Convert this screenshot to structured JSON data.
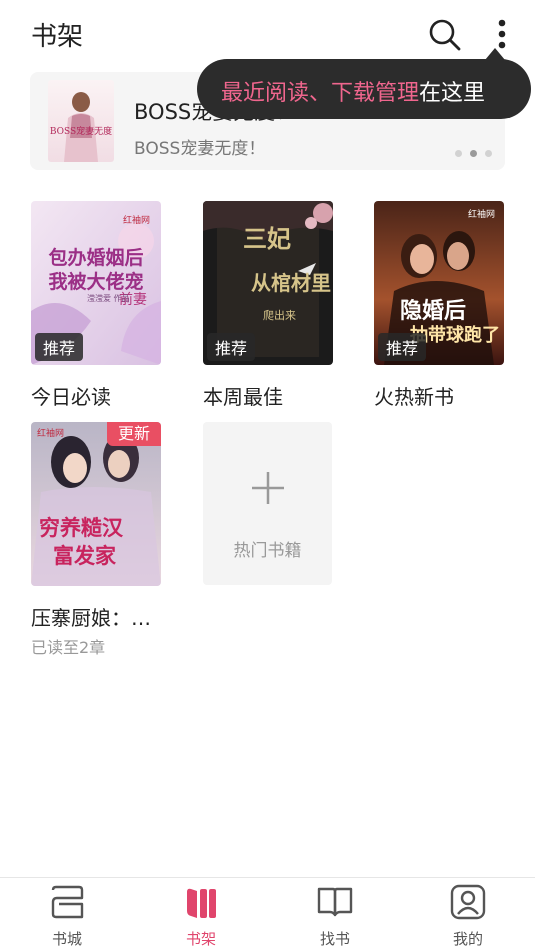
{
  "header": {
    "title": "书架",
    "search_icon": "search-icon",
    "more_icon": "more-vertical-icon"
  },
  "banner": {
    "title": "BOSS宠妻无度！",
    "desc": "BOSS宠妻无度！",
    "cover_text": "BOSS宠妻无度",
    "dots_count": 3,
    "active_dot": 1
  },
  "tooltip": {
    "highlight": "最近阅读、下载管理",
    "rest": "在这里"
  },
  "books": [
    {
      "title": "今日必读",
      "tag": "推荐",
      "cover_publisher": "红袖网",
      "cover_line1": "包办婚姻后",
      "cover_line2": "我被大佬宠",
      "cover_line3": "前妻",
      "cover_author": "滢滢爱 作品"
    },
    {
      "title": "本周最佳",
      "tag": "推荐",
      "cover_line1": "三妃",
      "cover_line2": "从棺材里",
      "cover_line3": "爬出来"
    },
    {
      "title": "火热新书",
      "tag": "推荐",
      "cover_publisher": "红袖网",
      "cover_line1": "隐婚后",
      "cover_line2": "抽带球跑了"
    },
    {
      "title": "压寨厨娘：…",
      "badge": "更新",
      "progress": "已读至2章",
      "cover_publisher": "红袖网",
      "cover_line1": "穷养糙汉",
      "cover_line2": "富发家"
    }
  ],
  "add_card": {
    "label": "热门书籍",
    "icon": "plus-icon"
  },
  "tabs": [
    {
      "label": "书城",
      "icon": "bookstore-icon",
      "active": false
    },
    {
      "label": "书架",
      "icon": "bookshelf-icon",
      "active": true
    },
    {
      "label": "找书",
      "icon": "open-book-icon",
      "active": false
    },
    {
      "label": "我的",
      "icon": "profile-icon",
      "active": false
    }
  ],
  "colors": {
    "accent": "#e0456c",
    "tooltip_bg": "#2c2c2c",
    "tooltip_highlight": "#f0668e",
    "update_badge": "#e94f63"
  }
}
